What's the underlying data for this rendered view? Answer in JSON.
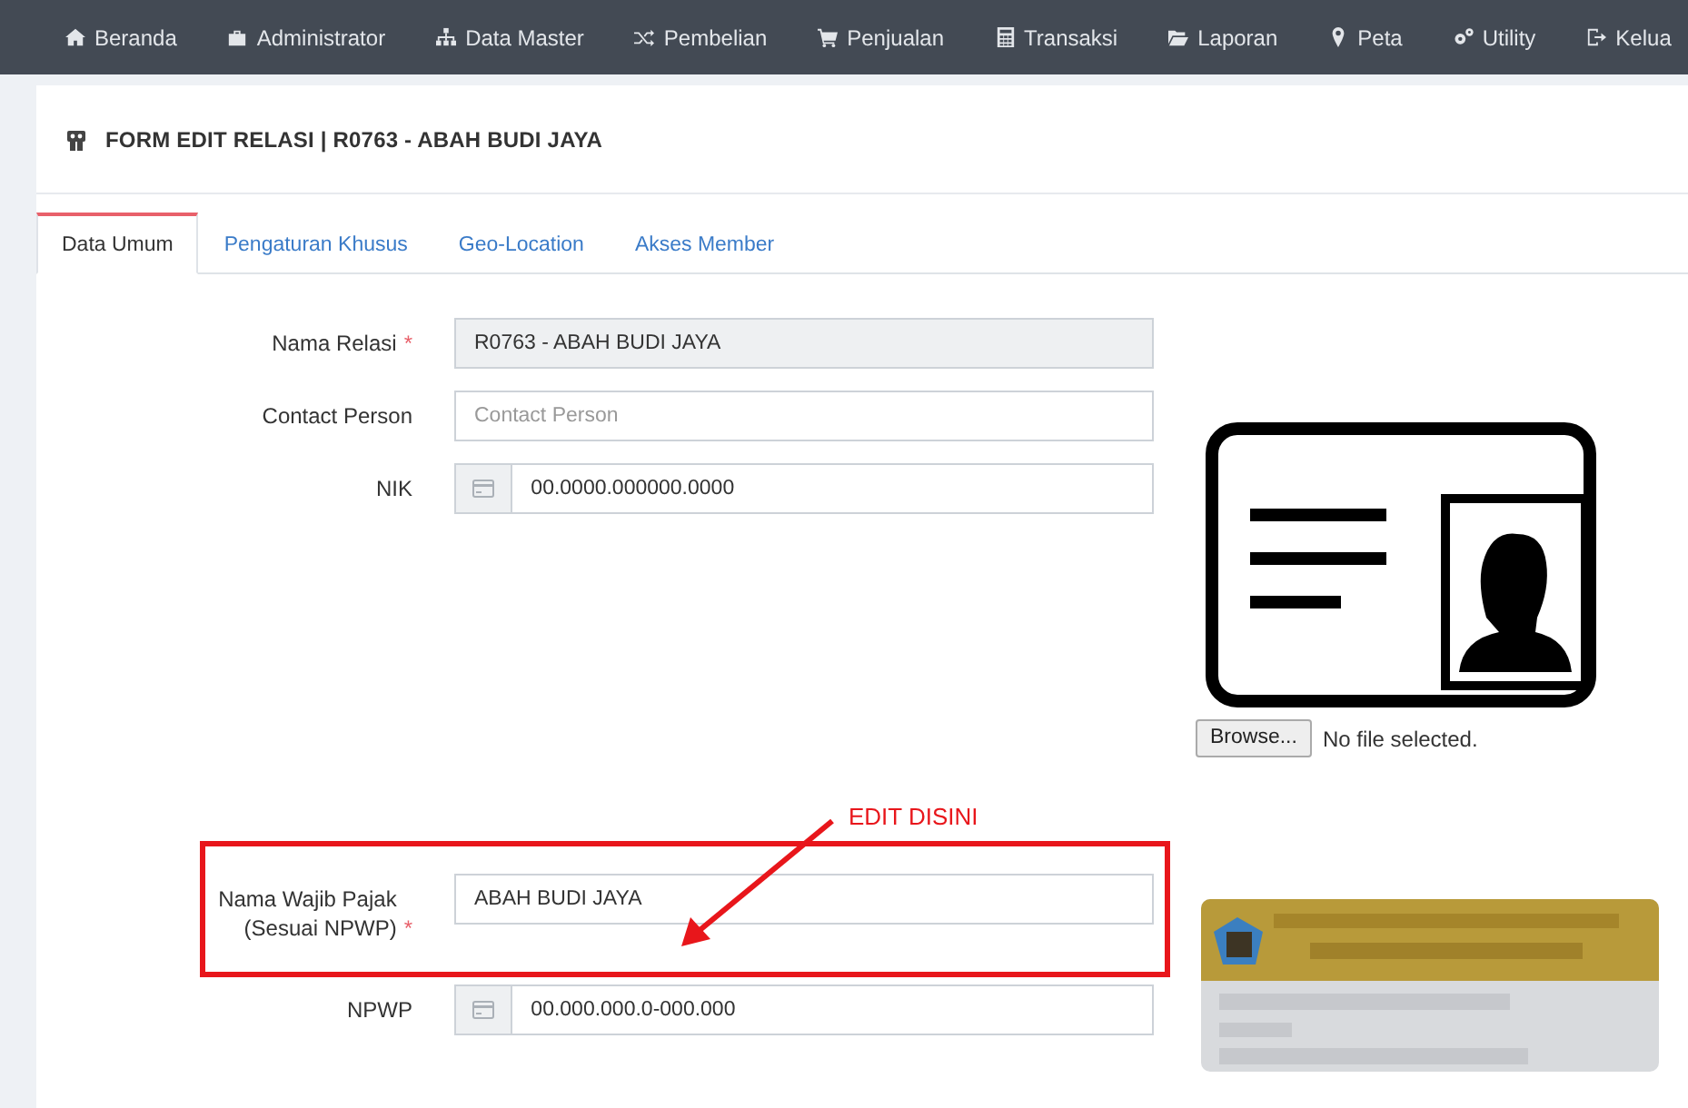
{
  "navbar": {
    "items": [
      {
        "label": "Beranda"
      },
      {
        "label": "Administrator"
      },
      {
        "label": "Data Master"
      },
      {
        "label": "Pembelian"
      },
      {
        "label": "Penjualan"
      },
      {
        "label": "Transaksi"
      },
      {
        "label": "Laporan"
      },
      {
        "label": "Peta"
      },
      {
        "label": "Utility"
      },
      {
        "label": "Kelua"
      }
    ]
  },
  "page_title": "FORM EDIT RELASI | R0763 - ABAH BUDI JAYA",
  "tabs": [
    {
      "label": "Data Umum",
      "selected": true
    },
    {
      "label": "Pengaturan Khusus",
      "selected": false
    },
    {
      "label": "Geo-Location",
      "selected": false
    },
    {
      "label": "Akses Member",
      "selected": false
    }
  ],
  "top_fields": [
    {
      "label": "Nama Relasi",
      "asterisk": "*",
      "kind": "text",
      "value": "R0763 - ABAH BUDI JAYA",
      "disabled": true,
      "highlighted": false
    },
    {
      "label": "Contact Person",
      "kind": "text",
      "placeholder": "Contact Person",
      "disabled": false,
      "highlighted": false
    },
    {
      "label": "NIK",
      "kind": "card",
      "value": "00.0000.000000.0000",
      "disabled": false,
      "highlighted": false
    }
  ],
  "bottom_fields": [
    {
      "label": "Nama Wajib Pajak (Sesuai NPWP)",
      "asterisk": "*",
      "kind": "text",
      "value": "ABAH BUDI JAYA",
      "disabled": false,
      "highlighted": true
    },
    {
      "label": "NPWP",
      "kind": "card",
      "value": "00.000.000.0-000.000",
      "disabled": false,
      "highlighted": false
    }
  ],
  "upload": {
    "button": "Browse...",
    "status": "No file selected."
  },
  "annotation": {
    "text": "EDIT DISINI"
  }
}
